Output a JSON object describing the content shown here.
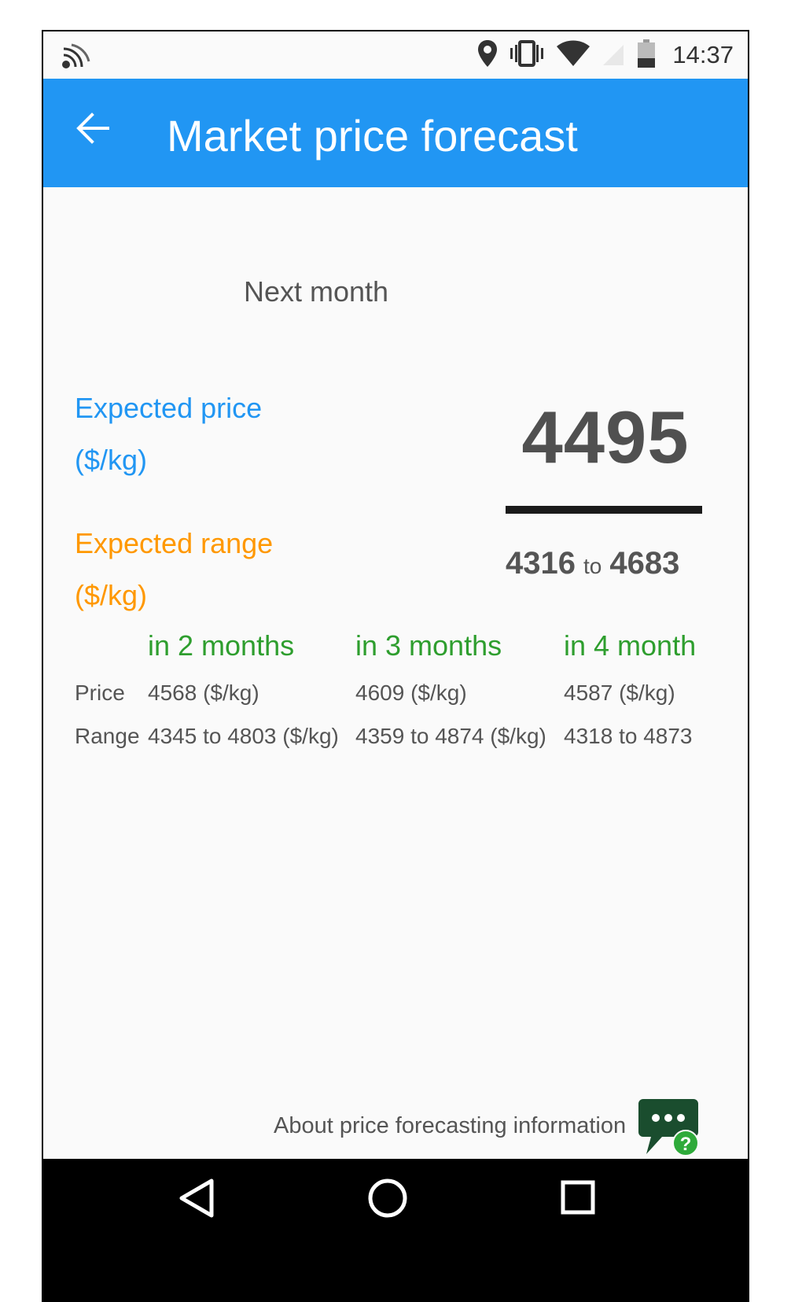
{
  "status_bar": {
    "time": "14:37",
    "icons": [
      "cast-icon",
      "location-icon",
      "vibrate-icon",
      "wifi-icon",
      "signal-icon",
      "battery-icon"
    ]
  },
  "app_bar": {
    "title": "Market price forecast",
    "back_icon": "arrow-back-icon",
    "color": "#2196f3"
  },
  "forecast": {
    "period_label": "Next month",
    "expected_price_label": "Expected price",
    "expected_price_unit": "($/kg)",
    "expected_price_value": "4495",
    "expected_range_label": "Expected range",
    "expected_range_unit": "($/kg)",
    "range_low": "4316",
    "range_to": "to",
    "range_high": "4683"
  },
  "table": {
    "row_labels": {
      "price": "Price",
      "range": "Range"
    },
    "columns": [
      {
        "header": "in 2 months",
        "price": "4568 ($/kg)",
        "range": "4345 to 4803 ($/kg)"
      },
      {
        "header": "in 3 months",
        "price": "4609 ($/kg)",
        "range": "4359 to 4874 ($/kg)"
      },
      {
        "header": "in 4 month",
        "price": "4587 ($/kg)",
        "range": "4318 to 4873"
      }
    ]
  },
  "footer": {
    "about_text": "About price forecasting information",
    "help_icon": "chat-help-icon"
  },
  "nav_bar": {
    "buttons": [
      "back-triangle-icon",
      "home-circle-icon",
      "recents-square-icon"
    ]
  },
  "colors": {
    "expected_price": "#2196f3",
    "expected_range": "#ff9800",
    "table_header": "#2e9e2e",
    "chat_icon": "#1a4d2e",
    "help_badge": "#2eaa3a"
  }
}
